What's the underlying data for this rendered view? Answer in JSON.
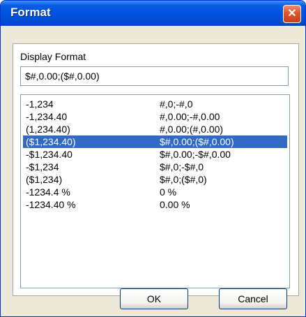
{
  "window": {
    "title": "Format",
    "close_glyph": "✕"
  },
  "display_format": {
    "label": "Display Format",
    "value": "$#,0.00;($#,0.00)"
  },
  "formats": [
    {
      "example": "-1,234",
      "pattern": "#,0;-#,0"
    },
    {
      "example": "-1,234.40",
      "pattern": "#,0.00;-#,0.00"
    },
    {
      "example": "(1,234.40)",
      "pattern": "#,0.00;(#,0.00)"
    },
    {
      "example": "($1,234.40)",
      "pattern": "$#,0.00;($#,0.00)"
    },
    {
      "example": "-$1,234.40",
      "pattern": "$#,0.00;-$#,0.00"
    },
    {
      "example": "-$1,234",
      "pattern": "$#,0;-$#,0"
    },
    {
      "example": "($1,234)",
      "pattern": "$#,0;($#,0)"
    },
    {
      "example": "-1234.4 %",
      "pattern": "0 %"
    },
    {
      "example": "-1234.40 %",
      "pattern": "0.00 %"
    }
  ],
  "selected_index": 3,
  "buttons": {
    "ok": "OK",
    "cancel": "Cancel"
  }
}
